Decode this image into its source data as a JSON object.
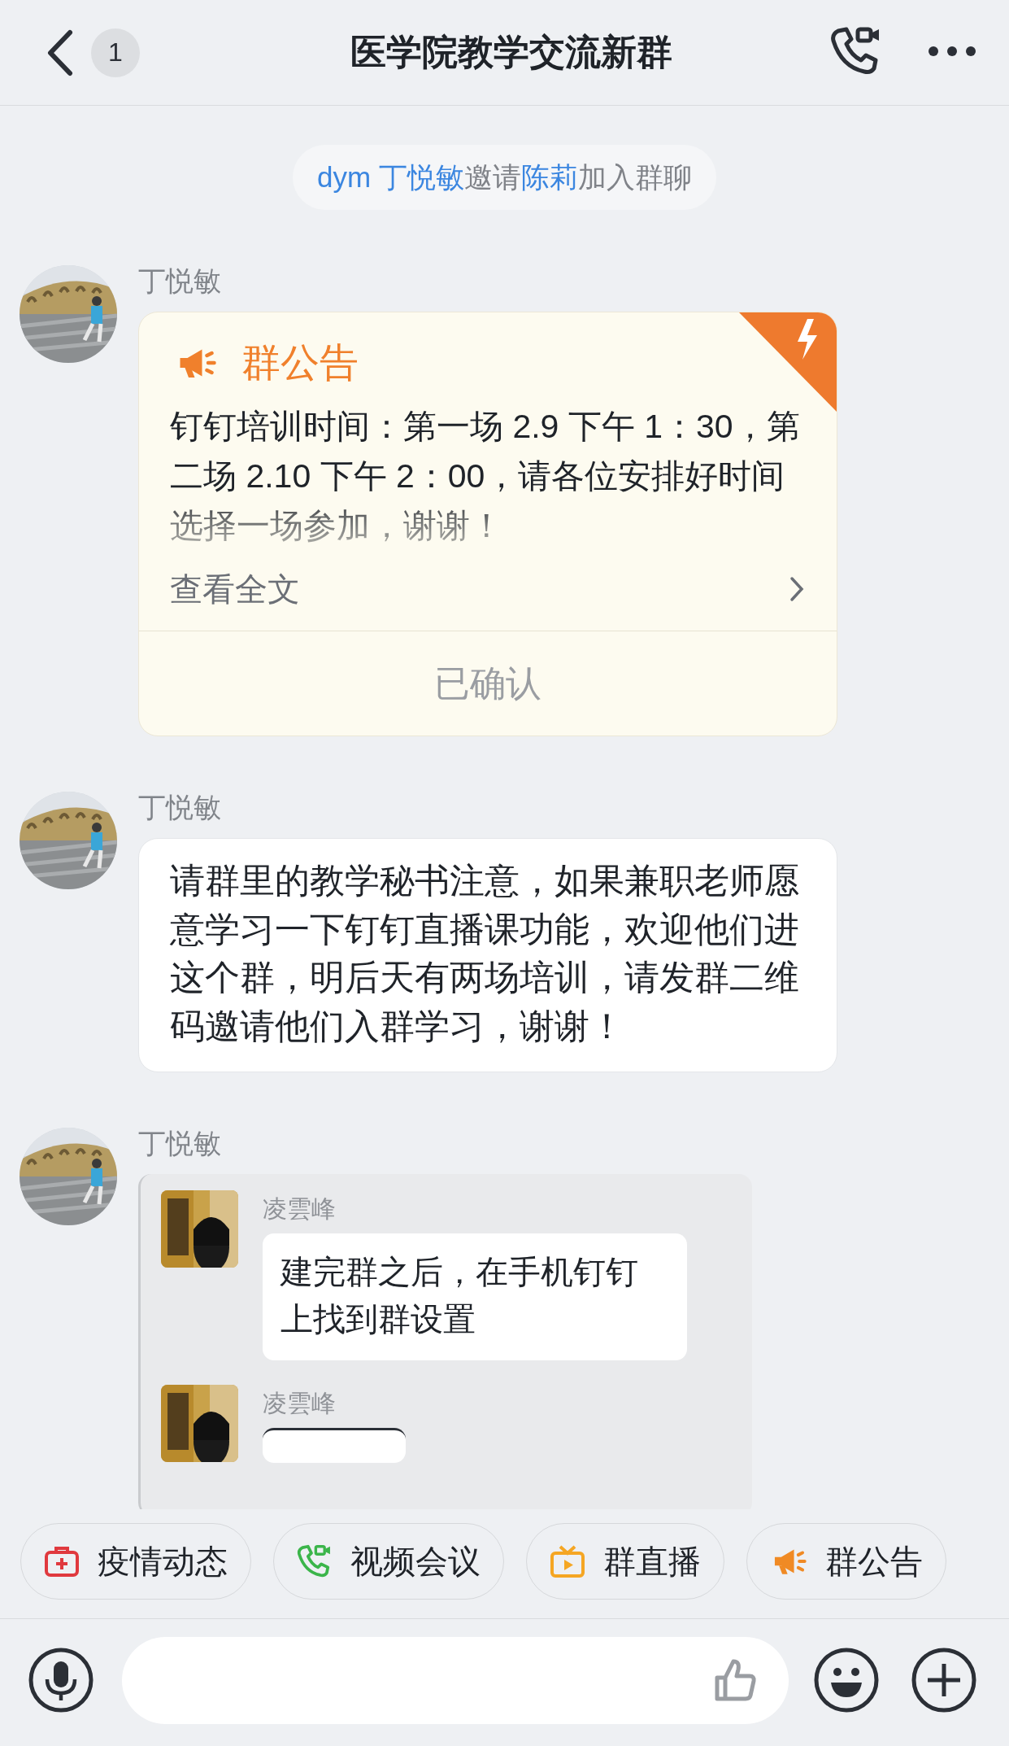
{
  "header": {
    "back_badge": "1",
    "title": "医学院教学交流新群"
  },
  "system_notice": {
    "parts": [
      {
        "text": "dym 丁悦敏",
        "kind": "link"
      },
      {
        "text": "邀请",
        "kind": "plain"
      },
      {
        "text": "陈莉",
        "kind": "link"
      },
      {
        "text": "加入群聊",
        "kind": "plain"
      }
    ]
  },
  "messages": [
    {
      "sender": "丁悦敏",
      "kind": "announcement",
      "title": "群公告",
      "body": "钉钉培训时间：第一场 2.9 下午 1：30，第二场 2.10 下午 2：00，请各位安排好时间选择一场参加，谢谢！",
      "link": "查看全文",
      "status": "已确认"
    },
    {
      "sender": "丁悦敏",
      "kind": "text",
      "text": "请群里的教学秘书注意，如果兼职老师愿意学习一下钉钉直播课功能，欢迎他们进这个群，明后天有两场培训，请发群二维码邀请他们入群学习，谢谢！"
    },
    {
      "sender": "丁悦敏",
      "kind": "forward",
      "items": [
        {
          "sender": "凌雲峰",
          "text": "建完群之后，在手机钉钉上找到群设置"
        },
        {
          "sender": "凌雲峰"
        }
      ]
    }
  ],
  "shortcuts": [
    {
      "label": "疫情动态",
      "kind": "medkit"
    },
    {
      "label": "视频会议",
      "kind": "video"
    },
    {
      "label": "群直播",
      "kind": "live"
    },
    {
      "label": "群公告",
      "kind": "notice"
    }
  ]
}
